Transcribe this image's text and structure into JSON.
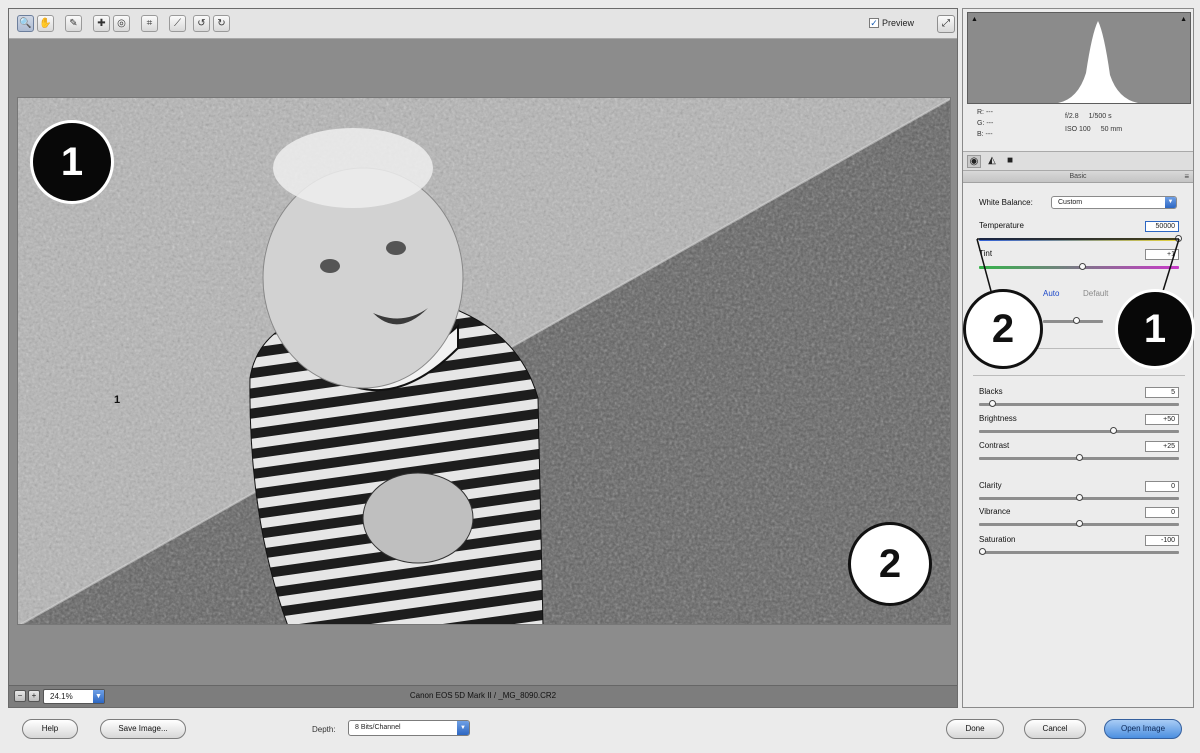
{
  "toolbar": {
    "tools": [
      {
        "icon": "zoom-tool-icon",
        "glyph": "🔍",
        "active": true
      },
      {
        "icon": "hand-tool-icon",
        "glyph": "✋"
      },
      {
        "icon": "white-balance-tool-icon",
        "glyph": "✎"
      },
      {
        "icon": "color-sampler-tool-icon",
        "glyph": "✚"
      },
      {
        "icon": "target-adjustment-tool-icon",
        "glyph": "◎"
      },
      {
        "icon": "crop-tool-icon",
        "glyph": "⌗"
      },
      {
        "icon": "straighten-tool-icon",
        "glyph": "⟋"
      },
      {
        "icon": "rotate-left-icon",
        "glyph": "↺"
      },
      {
        "icon": "rotate-right-icon",
        "glyph": "↻"
      }
    ],
    "preview_label": "Preview",
    "preview_checked": true
  },
  "photo": {
    "badges": [
      "1",
      "2"
    ],
    "small_marker": "1"
  },
  "statusbar": {
    "zoom": "24.1%",
    "file_info": "Canon EOS 5D Mark II  /  _MG_8090.CR2"
  },
  "histogram": {
    "clip_left": "▲",
    "clip_right": "▲"
  },
  "readout": {
    "r": "R: ---",
    "g": "G: ---",
    "b": "B: ---",
    "aperture": "f/2.8",
    "shutter": "1/500 s",
    "iso": "ISO 100",
    "focal": "50 mm"
  },
  "panel": {
    "section_title": "Basic",
    "white_balance_label": "White Balance:",
    "white_balance_value": "Custom",
    "temperature_label": "Temperature",
    "temperature_value": "50000",
    "tint_label": "Tint",
    "tint_value": "+1",
    "auto_label": "Auto",
    "default_label": "Default",
    "badges": [
      "2",
      "1"
    ],
    "sliders": [
      {
        "label": "Blacks",
        "value": "5",
        "pos": 0.05
      },
      {
        "label": "Brightness",
        "value": "+50",
        "pos": 0.68
      },
      {
        "label": "Contrast",
        "value": "+25",
        "pos": 0.5
      },
      {
        "label": "Clarity",
        "value": "0",
        "pos": 0.5
      },
      {
        "label": "Vibrance",
        "value": "0",
        "pos": 0.5
      },
      {
        "label": "Saturation",
        "value": "-100",
        "pos": 0.0
      }
    ]
  },
  "bottom": {
    "help": "Help",
    "save_image": "Save Image...",
    "depth_label": "Depth:",
    "depth_value": "8 Bits/Channel",
    "done": "Done",
    "cancel": "Cancel",
    "open_image": "Open Image"
  },
  "colors": {
    "accent_blue": "#2d67c2",
    "temp_gradient_start": "#2f5fd8",
    "temp_gradient_end": "#e8d43a",
    "tint_gradient_start": "#35b44a",
    "tint_gradient_end": "#c83ac8"
  }
}
